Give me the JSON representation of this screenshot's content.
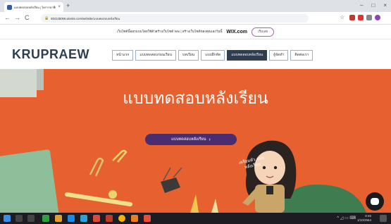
{
  "browser": {
    "tab_title": "แบบทดสอบหลังเรียน | ใครากษาพี่แพรว",
    "tab_close": "×",
    "new_tab": "+",
    "window_controls": [
      "–",
      "□",
      "×"
    ],
    "back": "←",
    "forward": "→",
    "reload": "C",
    "url": "604145066.wixsite.com/website/แบบทดสอบหลังเรียน",
    "star": "☆"
  },
  "wix_banner": {
    "message": "เว็บไซต์นี้ออกแบบโดยใช้ตัวสร้างเว็บไซต์ Wix | สร้างเว็บไซต์ของคุณเองวันนี้",
    "brand": "WIX.com",
    "start_label": "เริ่มเลย"
  },
  "site": {
    "logo": "KRUPRAEW",
    "menu": [
      {
        "label": "หน้าแรก"
      },
      {
        "label": "แบบทดสอบก่อนเรียน"
      },
      {
        "label": "บทเรียน"
      },
      {
        "label": "แบบฝึกหัด"
      },
      {
        "label": "แบบทดสอบหลังเรียน",
        "active": true
      },
      {
        "label": "ผู้จัดทำ"
      },
      {
        "label": "ติดต่อเรา"
      }
    ]
  },
  "hero": {
    "title": "แบบทดสอบหลังเรียน",
    "cta_label": "แบบทดสอบหลังเรียน",
    "cta_chevron": "›",
    "speech": "เตรียมตัว สอบหลังเรียน",
    "bg_color": "#e6612f"
  },
  "taskbar": {
    "tray_time": "9:45",
    "tray_date": "1/10/2564"
  }
}
